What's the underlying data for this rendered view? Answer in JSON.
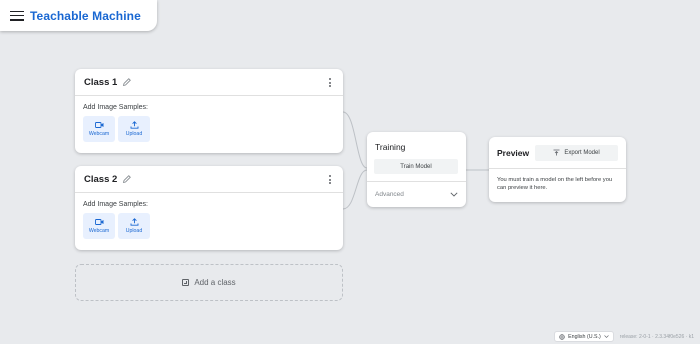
{
  "app": {
    "title": "Teachable Machine"
  },
  "classes": [
    {
      "name": "Class 1",
      "samples_label": "Add Image Samples:",
      "webcam_label": "Webcam",
      "upload_label": "Upload"
    },
    {
      "name": "Class 2",
      "samples_label": "Add Image Samples:",
      "webcam_label": "Webcam",
      "upload_label": "Upload"
    }
  ],
  "add_class": {
    "label": "Add a class"
  },
  "training": {
    "title": "Training",
    "train_button": "Train Model",
    "advanced_label": "Advanced"
  },
  "preview": {
    "title": "Preview",
    "export_button": "Export Model",
    "message": "You must train a model on the left before you can preview it here."
  },
  "footer": {
    "language": "English (U.S.)",
    "release": "release: 2-0-1 · 2.3.34f0e526 · k1"
  },
  "colors": {
    "accent": "#1967d2",
    "chip_bg": "#e8f0fe",
    "background": "#e8eaed"
  }
}
